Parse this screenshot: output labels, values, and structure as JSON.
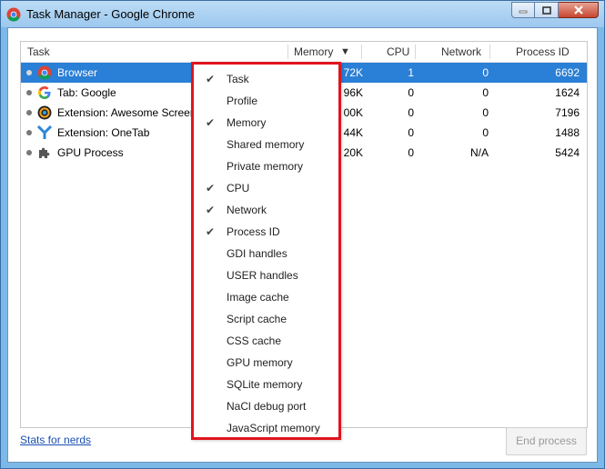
{
  "window": {
    "title": "Task Manager - Google Chrome"
  },
  "table": {
    "columns": [
      {
        "label": "Task"
      },
      {
        "label": "Memory"
      },
      {
        "label": "CPU"
      },
      {
        "label": "Network"
      },
      {
        "label": "Process ID"
      }
    ],
    "sort_indicator": "▼",
    "rows": [
      {
        "icon": "chrome-icon",
        "task": "Browser",
        "memory": "72K",
        "cpu": "1",
        "network": "0",
        "pid": "6692"
      },
      {
        "icon": "google-g-icon",
        "task": "Tab: Google",
        "memory": "96K",
        "cpu": "0",
        "network": "0",
        "pid": "1624"
      },
      {
        "icon": "awesome-screenshot-icon",
        "task": "Extension: Awesome Screens",
        "memory": "00K",
        "cpu": "0",
        "network": "0",
        "pid": "7196"
      },
      {
        "icon": "onetab-icon",
        "task": "Extension: OneTab",
        "memory": "44K",
        "cpu": "0",
        "network": "0",
        "pid": "1488"
      },
      {
        "icon": "puzzle-icon",
        "task": "GPU Process",
        "memory": "20K",
        "cpu": "0",
        "network": "N/A",
        "pid": "5424"
      }
    ]
  },
  "footer": {
    "stats_link": "Stats for nerds",
    "end_process": "End process"
  },
  "column_menu": {
    "check_mark": "✔",
    "items": [
      {
        "label": "Task",
        "checked": true
      },
      {
        "label": "Profile",
        "checked": false
      },
      {
        "label": "Memory",
        "checked": true
      },
      {
        "label": "Shared memory",
        "checked": false
      },
      {
        "label": "Private memory",
        "checked": false
      },
      {
        "label": "CPU",
        "checked": true
      },
      {
        "label": "Network",
        "checked": true
      },
      {
        "label": "Process ID",
        "checked": true
      },
      {
        "label": "GDI handles",
        "checked": false
      },
      {
        "label": "USER handles",
        "checked": false
      },
      {
        "label": "Image cache",
        "checked": false
      },
      {
        "label": "Script cache",
        "checked": false
      },
      {
        "label": "CSS cache",
        "checked": false
      },
      {
        "label": "GPU memory",
        "checked": false
      },
      {
        "label": "SQLite memory",
        "checked": false
      },
      {
        "label": "NaCl debug port",
        "checked": false
      },
      {
        "label": "JavaScript memory",
        "checked": false
      }
    ]
  },
  "colors": {
    "selection": "#2a7fd6",
    "menu_highlight_border": "#e0141e",
    "link": "#1a4fb3"
  }
}
